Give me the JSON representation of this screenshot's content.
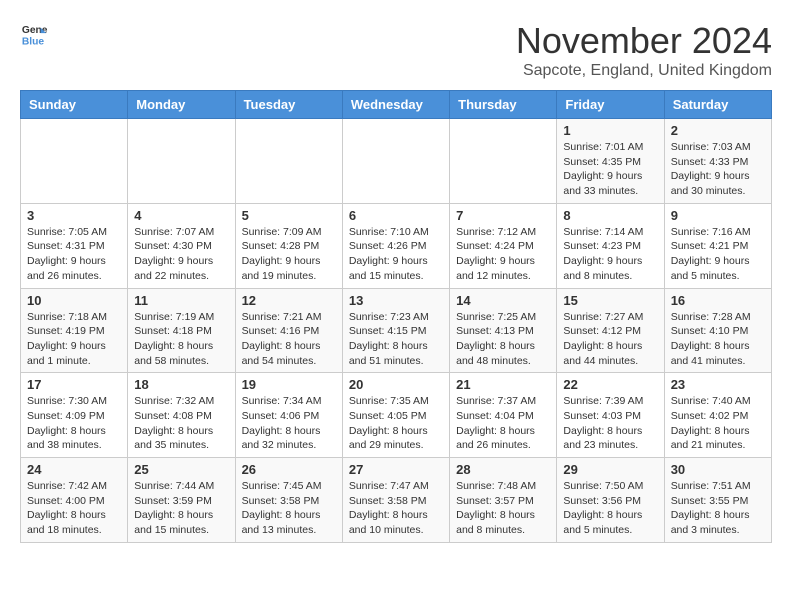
{
  "header": {
    "logo_line1": "General",
    "logo_line2": "Blue",
    "month_title": "November 2024",
    "subtitle": "Sapcote, England, United Kingdom"
  },
  "days_of_week": [
    "Sunday",
    "Monday",
    "Tuesday",
    "Wednesday",
    "Thursday",
    "Friday",
    "Saturday"
  ],
  "weeks": [
    [
      {
        "day": "",
        "info": ""
      },
      {
        "day": "",
        "info": ""
      },
      {
        "day": "",
        "info": ""
      },
      {
        "day": "",
        "info": ""
      },
      {
        "day": "",
        "info": ""
      },
      {
        "day": "1",
        "info": "Sunrise: 7:01 AM\nSunset: 4:35 PM\nDaylight: 9 hours and 33 minutes."
      },
      {
        "day": "2",
        "info": "Sunrise: 7:03 AM\nSunset: 4:33 PM\nDaylight: 9 hours and 30 minutes."
      }
    ],
    [
      {
        "day": "3",
        "info": "Sunrise: 7:05 AM\nSunset: 4:31 PM\nDaylight: 9 hours and 26 minutes."
      },
      {
        "day": "4",
        "info": "Sunrise: 7:07 AM\nSunset: 4:30 PM\nDaylight: 9 hours and 22 minutes."
      },
      {
        "day": "5",
        "info": "Sunrise: 7:09 AM\nSunset: 4:28 PM\nDaylight: 9 hours and 19 minutes."
      },
      {
        "day": "6",
        "info": "Sunrise: 7:10 AM\nSunset: 4:26 PM\nDaylight: 9 hours and 15 minutes."
      },
      {
        "day": "7",
        "info": "Sunrise: 7:12 AM\nSunset: 4:24 PM\nDaylight: 9 hours and 12 minutes."
      },
      {
        "day": "8",
        "info": "Sunrise: 7:14 AM\nSunset: 4:23 PM\nDaylight: 9 hours and 8 minutes."
      },
      {
        "day": "9",
        "info": "Sunrise: 7:16 AM\nSunset: 4:21 PM\nDaylight: 9 hours and 5 minutes."
      }
    ],
    [
      {
        "day": "10",
        "info": "Sunrise: 7:18 AM\nSunset: 4:19 PM\nDaylight: 9 hours and 1 minute."
      },
      {
        "day": "11",
        "info": "Sunrise: 7:19 AM\nSunset: 4:18 PM\nDaylight: 8 hours and 58 minutes."
      },
      {
        "day": "12",
        "info": "Sunrise: 7:21 AM\nSunset: 4:16 PM\nDaylight: 8 hours and 54 minutes."
      },
      {
        "day": "13",
        "info": "Sunrise: 7:23 AM\nSunset: 4:15 PM\nDaylight: 8 hours and 51 minutes."
      },
      {
        "day": "14",
        "info": "Sunrise: 7:25 AM\nSunset: 4:13 PM\nDaylight: 8 hours and 48 minutes."
      },
      {
        "day": "15",
        "info": "Sunrise: 7:27 AM\nSunset: 4:12 PM\nDaylight: 8 hours and 44 minutes."
      },
      {
        "day": "16",
        "info": "Sunrise: 7:28 AM\nSunset: 4:10 PM\nDaylight: 8 hours and 41 minutes."
      }
    ],
    [
      {
        "day": "17",
        "info": "Sunrise: 7:30 AM\nSunset: 4:09 PM\nDaylight: 8 hours and 38 minutes."
      },
      {
        "day": "18",
        "info": "Sunrise: 7:32 AM\nSunset: 4:08 PM\nDaylight: 8 hours and 35 minutes."
      },
      {
        "day": "19",
        "info": "Sunrise: 7:34 AM\nSunset: 4:06 PM\nDaylight: 8 hours and 32 minutes."
      },
      {
        "day": "20",
        "info": "Sunrise: 7:35 AM\nSunset: 4:05 PM\nDaylight: 8 hours and 29 minutes."
      },
      {
        "day": "21",
        "info": "Sunrise: 7:37 AM\nSunset: 4:04 PM\nDaylight: 8 hours and 26 minutes."
      },
      {
        "day": "22",
        "info": "Sunrise: 7:39 AM\nSunset: 4:03 PM\nDaylight: 8 hours and 23 minutes."
      },
      {
        "day": "23",
        "info": "Sunrise: 7:40 AM\nSunset: 4:02 PM\nDaylight: 8 hours and 21 minutes."
      }
    ],
    [
      {
        "day": "24",
        "info": "Sunrise: 7:42 AM\nSunset: 4:00 PM\nDaylight: 8 hours and 18 minutes."
      },
      {
        "day": "25",
        "info": "Sunrise: 7:44 AM\nSunset: 3:59 PM\nDaylight: 8 hours and 15 minutes."
      },
      {
        "day": "26",
        "info": "Sunrise: 7:45 AM\nSunset: 3:58 PM\nDaylight: 8 hours and 13 minutes."
      },
      {
        "day": "27",
        "info": "Sunrise: 7:47 AM\nSunset: 3:58 PM\nDaylight: 8 hours and 10 minutes."
      },
      {
        "day": "28",
        "info": "Sunrise: 7:48 AM\nSunset: 3:57 PM\nDaylight: 8 hours and 8 minutes."
      },
      {
        "day": "29",
        "info": "Sunrise: 7:50 AM\nSunset: 3:56 PM\nDaylight: 8 hours and 5 minutes."
      },
      {
        "day": "30",
        "info": "Sunrise: 7:51 AM\nSunset: 3:55 PM\nDaylight: 8 hours and 3 minutes."
      }
    ]
  ]
}
